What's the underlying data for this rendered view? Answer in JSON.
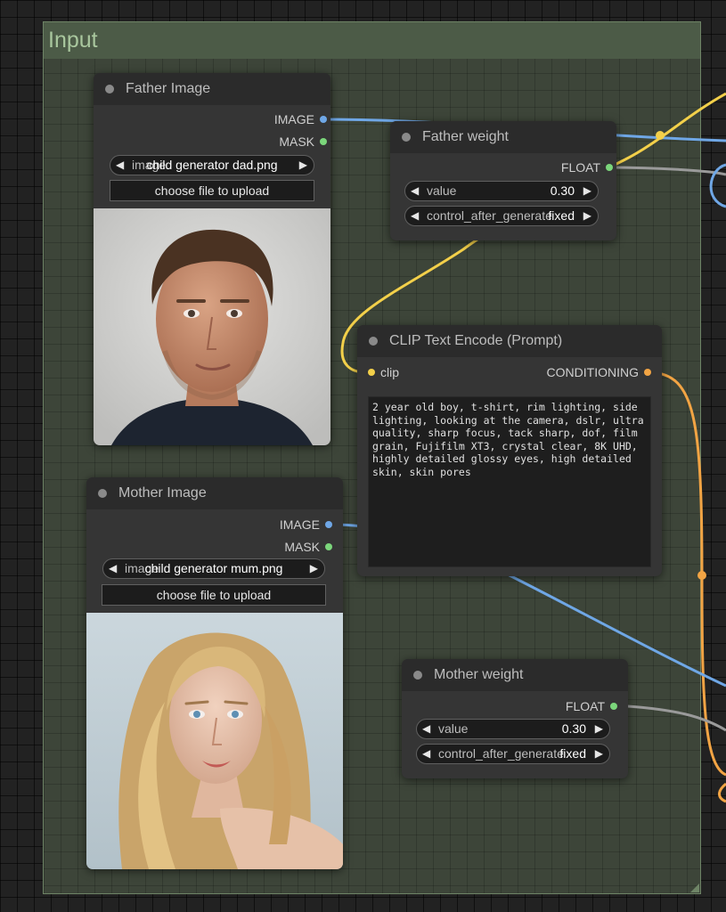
{
  "group": {
    "title": "Input"
  },
  "father_image": {
    "title": "Father Image",
    "outputs": [
      "IMAGE",
      "MASK"
    ],
    "image_label": "image",
    "image_value": "child generator dad.png",
    "upload_label": "choose file to upload"
  },
  "father_weight": {
    "title": "Father weight",
    "output": "FLOAT",
    "value_label": "value",
    "value": "0.30",
    "control_label": "control_after_generate",
    "control_value": "fixed"
  },
  "clip": {
    "title": "CLIP Text Encode (Prompt)",
    "input": "clip",
    "output": "CONDITIONING",
    "text": "2 year old boy, t-shirt, rim lighting, side lighting, looking at the camera, dslr, ultra quality, sharp focus, tack sharp, dof, film grain, Fujifilm XT3, crystal clear, 8K UHD, highly detailed glossy eyes, high detailed skin, skin pores"
  },
  "mother_image": {
    "title": "Mother Image",
    "outputs": [
      "IMAGE",
      "MASK"
    ],
    "image_label": "image",
    "image_value": "child generator mum.png",
    "upload_label": "choose file to upload"
  },
  "mother_weight": {
    "title": "Mother weight",
    "output": "FLOAT",
    "value_label": "value",
    "value": "0.30",
    "control_label": "control_after_generate",
    "control_value": "fixed"
  },
  "colors": {
    "image_link": "#6fa7e6",
    "clip_link": "#f3d04a",
    "conditioning_link": "#f2a444",
    "float_link": "#9a9a9a",
    "group_bg": "#3d4539"
  }
}
